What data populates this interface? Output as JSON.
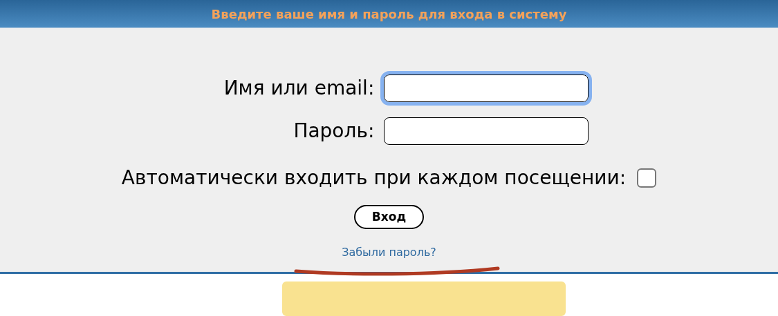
{
  "header": {
    "title": "Введите ваше имя и пароль для входа в систему"
  },
  "fields": [
    {
      "label": "Имя или email:",
      "focused": true
    },
    {
      "label": "Пароль:",
      "focused": false
    }
  ],
  "autologin": {
    "label": "Автоматически входить при каждом посещении:",
    "checked": false
  },
  "login_button": "Вход",
  "forgot_link": "Забыли пароль?"
}
